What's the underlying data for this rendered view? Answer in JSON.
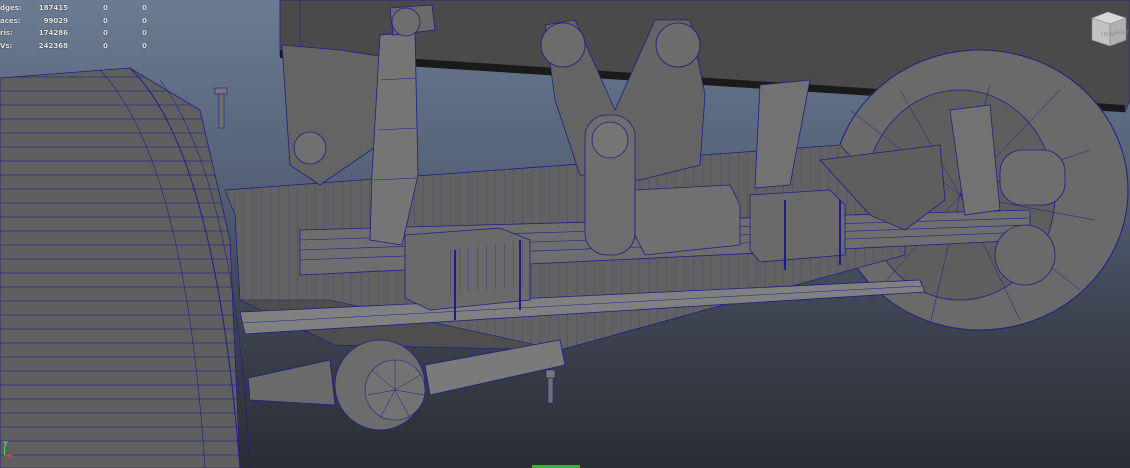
{
  "hud": {
    "rows": [
      {
        "label": "dges:",
        "v1": "187415",
        "v2": "0",
        "v3": "0"
      },
      {
        "label": "aces:",
        "v1": "99029",
        "v2": "0",
        "v3": "0"
      },
      {
        "label": "ris:",
        "v1": "174286",
        "v2": "0",
        "v3": "0"
      },
      {
        "label": "Vs:",
        "v1": "242368",
        "v2": "0",
        "v3": "0"
      }
    ]
  },
  "viewcube": {
    "front": "FRONT",
    "right": "RIGHT"
  },
  "axis": {
    "y": "Y",
    "x": "x"
  },
  "colors": {
    "wire": "#1e1e8a",
    "mesh": "#6d6d6d",
    "mesh_dark": "#4c4c4c",
    "mesh_light": "#8a8a8a",
    "frame": "#3a3a3a"
  }
}
